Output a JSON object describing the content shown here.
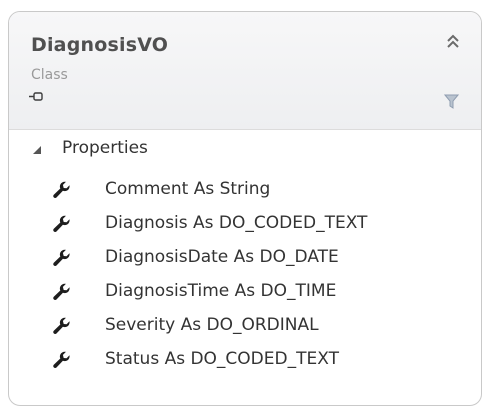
{
  "class_box": {
    "name": "DiagnosisVO",
    "stereotype": "Class",
    "collapse_icon": "double-chevron-up-icon",
    "connector_icon": "connector-icon",
    "filter_icon": "filter-icon"
  },
  "section": {
    "label": "Properties",
    "expanded": true,
    "items": [
      {
        "label": "Comment As String",
        "icon": "wrench-icon"
      },
      {
        "label": "Diagnosis As DO_CODED_TEXT",
        "icon": "wrench-icon"
      },
      {
        "label": "DiagnosisDate As DO_DATE",
        "icon": "wrench-icon"
      },
      {
        "label": "DiagnosisTime As DO_TIME",
        "icon": "wrench-icon"
      },
      {
        "label": "Severity As DO_ORDINAL",
        "icon": "wrench-icon"
      },
      {
        "label": "Status As DO_CODED_TEXT",
        "icon": "wrench-icon"
      }
    ]
  },
  "colors": {
    "border": "#c9c9c9",
    "header_bg": "#f0f1f3",
    "title_text": "#505050",
    "stereotype_text": "#9a9a9a",
    "body_text": "#333333",
    "icon": "#1e1e1e",
    "filter_icon": "#8f9db0"
  }
}
